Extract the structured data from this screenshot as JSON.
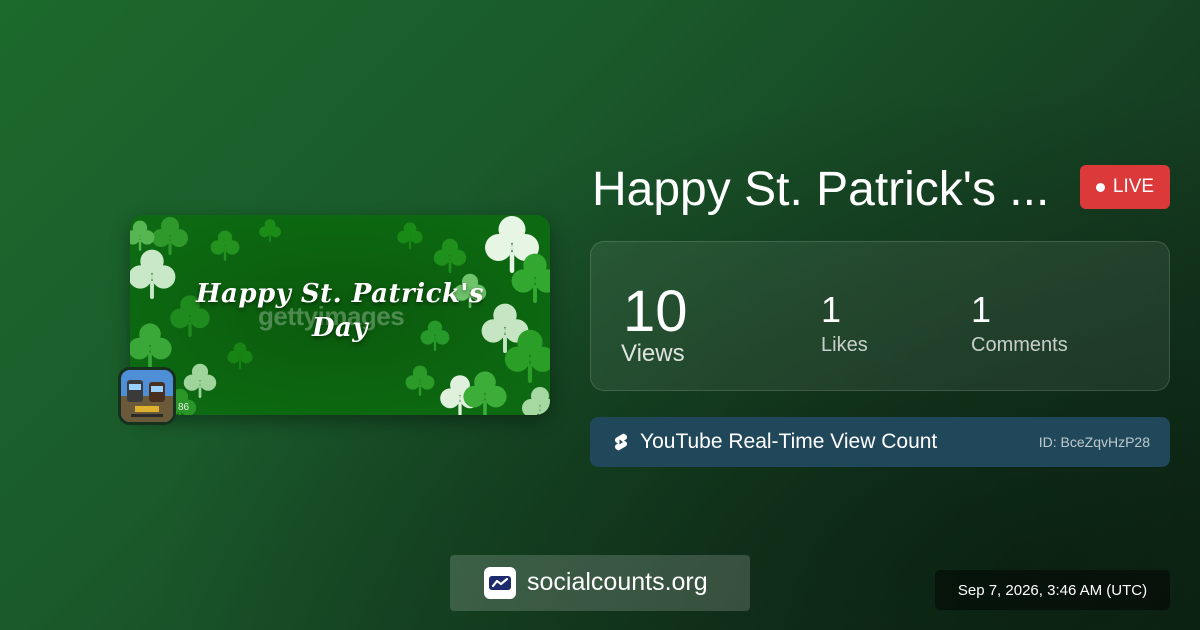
{
  "video": {
    "title": "Happy St. Patrick's ...",
    "thumbnail_text": "Happy St. Patrick's Day",
    "thumbnail_watermark": "gettyimages",
    "channel_avatar_text": "86"
  },
  "live_badge": {
    "label": "LIVE",
    "color": "#dc3a3a"
  },
  "stats": {
    "views": {
      "value": "10",
      "label": "Views"
    },
    "likes": {
      "value": "1",
      "label": "Likes"
    },
    "comments": {
      "value": "1",
      "label": "Comments"
    }
  },
  "source": {
    "icon": "youtube-shorts-icon",
    "label": "YouTube Real-Time View Count",
    "id": "ID: BceZqvHzP28"
  },
  "site": {
    "icon": "socialcounts-logo-icon",
    "label": "socialcounts.org"
  },
  "timestamp": "Sep 7, 2026, 3:46 AM (UTC)",
  "colors": {
    "background": "#1a5a2b",
    "accent_live": "#dc3a3a",
    "source_bar": "#21485a",
    "thumbnail_green": "#0d6a12"
  }
}
